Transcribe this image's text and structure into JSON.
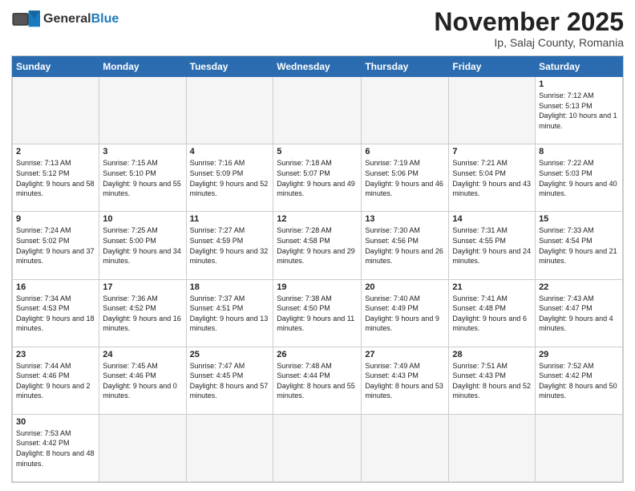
{
  "logo": {
    "text_general": "General",
    "text_blue": "Blue"
  },
  "header": {
    "month_year": "November 2025",
    "location": "Ip, Salaj County, Romania"
  },
  "days_of_week": [
    "Sunday",
    "Monday",
    "Tuesday",
    "Wednesday",
    "Thursday",
    "Friday",
    "Saturday"
  ],
  "weeks": [
    [
      {
        "day": "",
        "empty": true
      },
      {
        "day": "",
        "empty": true
      },
      {
        "day": "",
        "empty": true
      },
      {
        "day": "",
        "empty": true
      },
      {
        "day": "",
        "empty": true
      },
      {
        "day": "",
        "empty": true
      },
      {
        "day": "1",
        "sunrise": "7:12 AM",
        "sunset": "5:13 PM",
        "daylight": "10 hours and 1 minute."
      }
    ],
    [
      {
        "day": "2",
        "sunrise": "7:13 AM",
        "sunset": "5:12 PM",
        "daylight": "9 hours and 58 minutes."
      },
      {
        "day": "3",
        "sunrise": "7:15 AM",
        "sunset": "5:10 PM",
        "daylight": "9 hours and 55 minutes."
      },
      {
        "day": "4",
        "sunrise": "7:16 AM",
        "sunset": "5:09 PM",
        "daylight": "9 hours and 52 minutes."
      },
      {
        "day": "5",
        "sunrise": "7:18 AM",
        "sunset": "5:07 PM",
        "daylight": "9 hours and 49 minutes."
      },
      {
        "day": "6",
        "sunrise": "7:19 AM",
        "sunset": "5:06 PM",
        "daylight": "9 hours and 46 minutes."
      },
      {
        "day": "7",
        "sunrise": "7:21 AM",
        "sunset": "5:04 PM",
        "daylight": "9 hours and 43 minutes."
      },
      {
        "day": "8",
        "sunrise": "7:22 AM",
        "sunset": "5:03 PM",
        "daylight": "9 hours and 40 minutes."
      }
    ],
    [
      {
        "day": "9",
        "sunrise": "7:24 AM",
        "sunset": "5:02 PM",
        "daylight": "9 hours and 37 minutes."
      },
      {
        "day": "10",
        "sunrise": "7:25 AM",
        "sunset": "5:00 PM",
        "daylight": "9 hours and 34 minutes."
      },
      {
        "day": "11",
        "sunrise": "7:27 AM",
        "sunset": "4:59 PM",
        "daylight": "9 hours and 32 minutes."
      },
      {
        "day": "12",
        "sunrise": "7:28 AM",
        "sunset": "4:58 PM",
        "daylight": "9 hours and 29 minutes."
      },
      {
        "day": "13",
        "sunrise": "7:30 AM",
        "sunset": "4:56 PM",
        "daylight": "9 hours and 26 minutes."
      },
      {
        "day": "14",
        "sunrise": "7:31 AM",
        "sunset": "4:55 PM",
        "daylight": "9 hours and 24 minutes."
      },
      {
        "day": "15",
        "sunrise": "7:33 AM",
        "sunset": "4:54 PM",
        "daylight": "9 hours and 21 minutes."
      }
    ],
    [
      {
        "day": "16",
        "sunrise": "7:34 AM",
        "sunset": "4:53 PM",
        "daylight": "9 hours and 18 minutes."
      },
      {
        "day": "17",
        "sunrise": "7:36 AM",
        "sunset": "4:52 PM",
        "daylight": "9 hours and 16 minutes."
      },
      {
        "day": "18",
        "sunrise": "7:37 AM",
        "sunset": "4:51 PM",
        "daylight": "9 hours and 13 minutes."
      },
      {
        "day": "19",
        "sunrise": "7:38 AM",
        "sunset": "4:50 PM",
        "daylight": "9 hours and 11 minutes."
      },
      {
        "day": "20",
        "sunrise": "7:40 AM",
        "sunset": "4:49 PM",
        "daylight": "9 hours and 9 minutes."
      },
      {
        "day": "21",
        "sunrise": "7:41 AM",
        "sunset": "4:48 PM",
        "daylight": "9 hours and 6 minutes."
      },
      {
        "day": "22",
        "sunrise": "7:43 AM",
        "sunset": "4:47 PM",
        "daylight": "9 hours and 4 minutes."
      }
    ],
    [
      {
        "day": "23",
        "sunrise": "7:44 AM",
        "sunset": "4:46 PM",
        "daylight": "9 hours and 2 minutes."
      },
      {
        "day": "24",
        "sunrise": "7:45 AM",
        "sunset": "4:46 PM",
        "daylight": "9 hours and 0 minutes."
      },
      {
        "day": "25",
        "sunrise": "7:47 AM",
        "sunset": "4:45 PM",
        "daylight": "8 hours and 57 minutes."
      },
      {
        "day": "26",
        "sunrise": "7:48 AM",
        "sunset": "4:44 PM",
        "daylight": "8 hours and 55 minutes."
      },
      {
        "day": "27",
        "sunrise": "7:49 AM",
        "sunset": "4:43 PM",
        "daylight": "8 hours and 53 minutes."
      },
      {
        "day": "28",
        "sunrise": "7:51 AM",
        "sunset": "4:43 PM",
        "daylight": "8 hours and 52 minutes."
      },
      {
        "day": "29",
        "sunrise": "7:52 AM",
        "sunset": "4:42 PM",
        "daylight": "8 hours and 50 minutes."
      }
    ],
    [
      {
        "day": "30",
        "sunrise": "7:53 AM",
        "sunset": "4:42 PM",
        "daylight": "8 hours and 48 minutes."
      },
      {
        "day": "",
        "empty": true
      },
      {
        "day": "",
        "empty": true
      },
      {
        "day": "",
        "empty": true
      },
      {
        "day": "",
        "empty": true
      },
      {
        "day": "",
        "empty": true
      },
      {
        "day": "",
        "empty": true
      }
    ]
  ]
}
